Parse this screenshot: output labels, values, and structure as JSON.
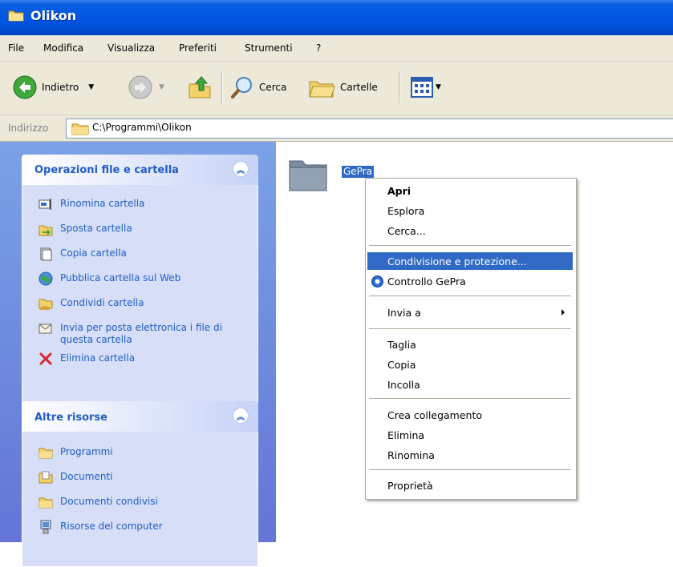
{
  "window": {
    "title": "Olikon"
  },
  "menubar": [
    "File",
    "Modifica",
    "Visualizza",
    "Preferiti",
    "Strumenti",
    "?"
  ],
  "toolbar": {
    "back": "Indietro",
    "search": "Cerca",
    "folders": "Cartelle"
  },
  "address": {
    "label": "Indirizzo",
    "path": "C:\\Programmi\\Olikon"
  },
  "tasks_panel": {
    "title": "Operazioni file e cartella",
    "items": [
      {
        "label": "Rinomina cartella",
        "icon": "rename-icon"
      },
      {
        "label": "Sposta cartella",
        "icon": "move-icon"
      },
      {
        "label": "Copia cartella",
        "icon": "copy-icon"
      },
      {
        "label": "Pubblica cartella sul Web",
        "icon": "publish-web-icon"
      },
      {
        "label": "Condividi cartella",
        "icon": "share-icon"
      },
      {
        "label": "Invia per posta elettronica i file di questa cartella",
        "icon": "email-icon"
      },
      {
        "label": "Elimina cartella",
        "icon": "delete-icon"
      }
    ]
  },
  "other_panel": {
    "title": "Altre risorse",
    "items": [
      {
        "label": "Programmi",
        "icon": "folder-icon"
      },
      {
        "label": "Documenti",
        "icon": "documents-icon"
      },
      {
        "label": "Documenti condivisi",
        "icon": "folder-icon"
      },
      {
        "label": "Risorse del computer",
        "icon": "computer-icon"
      }
    ]
  },
  "content": {
    "folder_name": "GePra"
  },
  "context_menu": {
    "open": "Apri",
    "explore": "Esplora",
    "search": "Cerca...",
    "sharing": "Condivisione e protezione...",
    "gepra_control": "Controllo GePra",
    "send_to": "Invia a",
    "cut": "Taglia",
    "copy": "Copia",
    "paste": "Incolla",
    "create_shortcut": "Crea collegamento",
    "delete": "Elimina",
    "rename": "Rinomina",
    "properties": "Proprietà"
  },
  "colors": {
    "titlebar": "#0054e3",
    "taskpane": "#7ba2e7",
    "link": "#215dc6",
    "selection": "#316ac5"
  }
}
